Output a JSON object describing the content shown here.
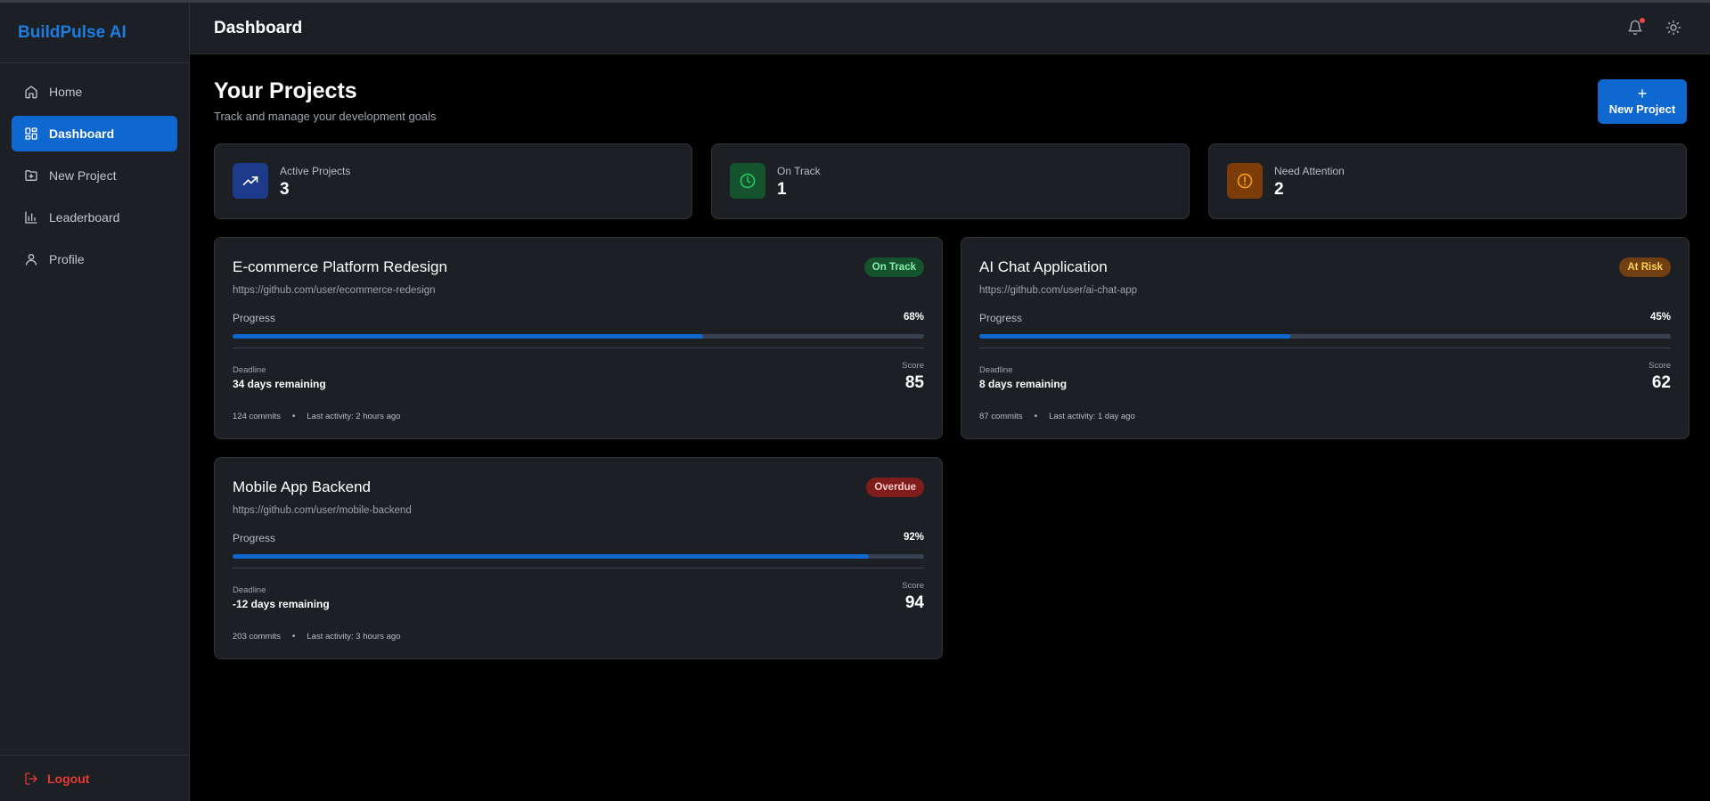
{
  "app": {
    "brand": "BuildPulse AI"
  },
  "sidebar": {
    "items": [
      {
        "label": "Home",
        "icon": "home-icon"
      },
      {
        "label": "Dashboard",
        "icon": "dashboard-icon",
        "active": true
      },
      {
        "label": "New Project",
        "icon": "folder-plus-icon"
      },
      {
        "label": "Leaderboard",
        "icon": "bar-chart-icon"
      },
      {
        "label": "Profile",
        "icon": "user-icon"
      }
    ],
    "logout_label": "Logout"
  },
  "header": {
    "title": "Dashboard"
  },
  "main": {
    "title": "Your Projects",
    "subtitle": "Track and manage your development goals",
    "new_project_label": "New Project"
  },
  "stats": [
    {
      "label": "Active Projects",
      "value": "3",
      "icon": "trending-up-icon",
      "color": "#1e3a8a"
    },
    {
      "label": "On Track",
      "value": "1",
      "icon": "clock-icon",
      "color": "#14532d"
    },
    {
      "label": "Need Attention",
      "value": "2",
      "icon": "alert-circle-icon",
      "color": "#7c3c0a"
    }
  ],
  "projects": [
    {
      "title": "E-commerce Platform Redesign",
      "url": "https://github.com/user/ecommerce-redesign",
      "status": "On Track",
      "status_bg": "#14532d",
      "status_color": "#86efac",
      "progress_label": "Progress",
      "progress_text": "68%",
      "progress": 0.68,
      "deadline_label": "Deadline",
      "deadline": "34 days remaining",
      "score_label": "Score",
      "score": "85",
      "commits": "124 commits",
      "activity": "Last activity: 2 hours ago"
    },
    {
      "title": "AI Chat Application",
      "url": "https://github.com/user/ai-chat-app",
      "status": "At Risk",
      "status_bg": "#713f12",
      "status_color": "#fcd34d",
      "progress_label": "Progress",
      "progress_text": "45%",
      "progress": 0.45,
      "deadline_label": "Deadline",
      "deadline": "8 days remaining",
      "score_label": "Score",
      "score": "62",
      "commits": "87 commits",
      "activity": "Last activity: 1 day ago"
    },
    {
      "title": "Mobile App Backend",
      "url": "https://github.com/user/mobile-backend",
      "status": "Overdue",
      "status_bg": "#7f1d1d",
      "status_color": "#fecaca",
      "progress_label": "Progress",
      "progress_text": "92%",
      "progress": 0.92,
      "deadline_label": "Deadline",
      "deadline": "-12 days remaining",
      "score_label": "Score",
      "score": "94",
      "commits": "203 commits",
      "activity": "Last activity: 3 hours ago"
    }
  ],
  "meta_separator": "•",
  "colors": {
    "accent": "#0f67d0",
    "brand": "#1d7ce0",
    "danger": "#e53935",
    "notification_dot": "#ef4444"
  }
}
